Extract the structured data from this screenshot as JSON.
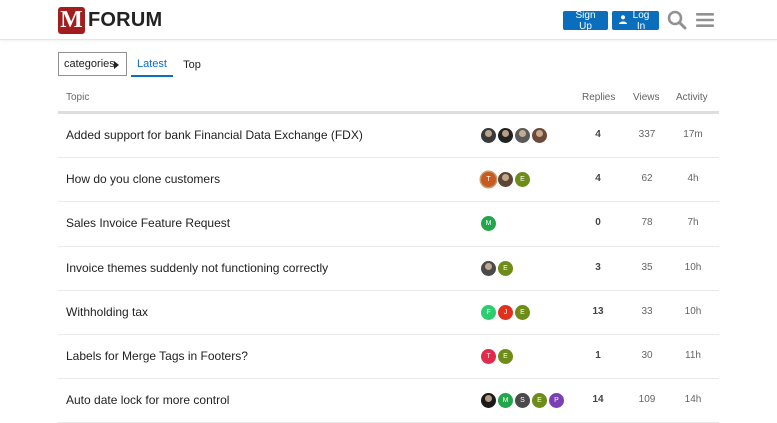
{
  "header": {
    "logo_letter": "M",
    "logo_text": "FORUM",
    "signup_label": "Sign Up",
    "login_label": "Log In",
    "colors": {
      "primary": "#0a6ebd",
      "logo": "#a31d1d"
    }
  },
  "nav": {
    "category_label": "categories",
    "tabs": [
      {
        "label": "Latest",
        "active": true
      },
      {
        "label": "Top",
        "active": false
      }
    ]
  },
  "table": {
    "columns": {
      "topic": "Topic",
      "replies": "Replies",
      "views": "Views",
      "activity": "Activity"
    },
    "rows": [
      {
        "title": "Added support for bank Financial Data Exchange (FDX)",
        "posters": [
          {
            "letter": "",
            "color": "#3a3a3a",
            "photo": true
          },
          {
            "letter": "",
            "color": "#222222",
            "photo": true
          },
          {
            "letter": "",
            "color": "#5a5a5a",
            "photo": true
          },
          {
            "letter": "",
            "color": "#6b4a3a",
            "photo": true
          }
        ],
        "replies": "4",
        "views": "337",
        "activity": "17m"
      },
      {
        "title": "How do you clone customers",
        "posters": [
          {
            "letter": "T",
            "color": "#c9591f",
            "photo": false,
            "ring": true
          },
          {
            "letter": "",
            "color": "#5b4636",
            "photo": true
          },
          {
            "letter": "E",
            "color": "#6e8c1a",
            "photo": false
          }
        ],
        "replies": "4",
        "views": "62",
        "activity": "4h"
      },
      {
        "title": "Sales Invoice Feature Request",
        "posters": [
          {
            "letter": "M",
            "color": "#21a64a",
            "photo": false
          }
        ],
        "replies": "0",
        "views": "78",
        "activity": "7h"
      },
      {
        "title": "Invoice themes suddenly not functioning correctly",
        "posters": [
          {
            "letter": "",
            "color": "#4a4a4a",
            "photo": true
          },
          {
            "letter": "E",
            "color": "#6e8c1a",
            "photo": false
          }
        ],
        "replies": "3",
        "views": "35",
        "activity": "10h"
      },
      {
        "title": "Withholding tax",
        "posters": [
          {
            "letter": "F",
            "color": "#2ecc71",
            "photo": false
          },
          {
            "letter": "J",
            "color": "#e2301c",
            "photo": false
          },
          {
            "letter": "E",
            "color": "#6e8c1a",
            "photo": false
          }
        ],
        "replies": "13",
        "views": "33",
        "activity": "10h"
      },
      {
        "title": "Labels for Merge Tags in Footers?",
        "posters": [
          {
            "letter": "T",
            "color": "#e02c4a",
            "photo": false
          },
          {
            "letter": "E",
            "color": "#6e8c1a",
            "photo": false
          }
        ],
        "replies": "1",
        "views": "30",
        "activity": "11h"
      },
      {
        "title": "Auto date lock for more control",
        "posters": [
          {
            "letter": "",
            "color": "#1a1a1a",
            "photo": true
          },
          {
            "letter": "M",
            "color": "#21a64a",
            "photo": false
          },
          {
            "letter": "S",
            "color": "#4a4a4a",
            "photo": false
          },
          {
            "letter": "E",
            "color": "#6e8c1a",
            "photo": false
          },
          {
            "letter": "P",
            "color": "#7a3fb5",
            "photo": false
          }
        ],
        "replies": "14",
        "views": "109",
        "activity": "14h"
      }
    ]
  }
}
